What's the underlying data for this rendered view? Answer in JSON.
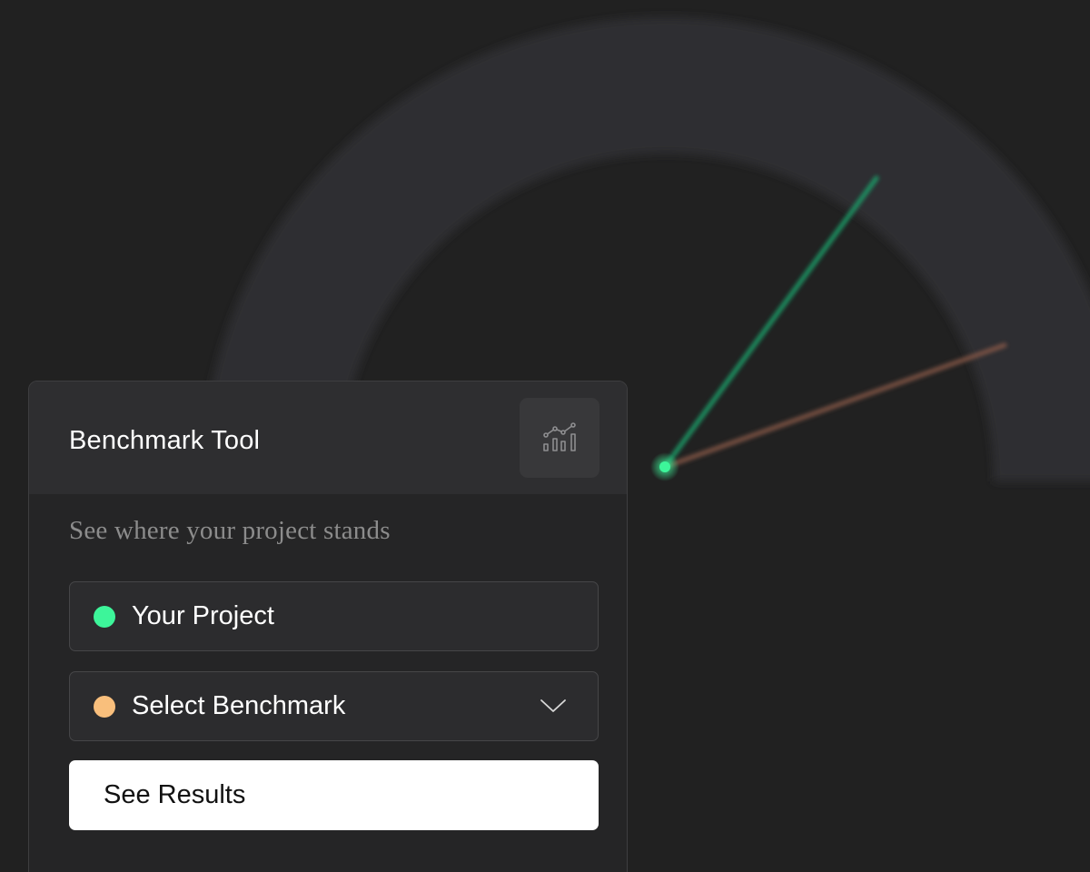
{
  "card": {
    "title": "Benchmark Tool",
    "subtitle": "See where your project stands",
    "chart_icon": "chart-bars-trend-icon"
  },
  "fields": {
    "project": {
      "label": "Your Project",
      "dot_color": "#3df59a"
    },
    "benchmark": {
      "label": "Select Benchmark",
      "dot_color": "#f9bf7c"
    }
  },
  "actions": {
    "see_results_label": "See Results"
  },
  "gauge": {
    "project_needle_color": "#1fa06a",
    "benchmark_needle_color": "#8a5a48",
    "track_color": "#2e2e30"
  }
}
